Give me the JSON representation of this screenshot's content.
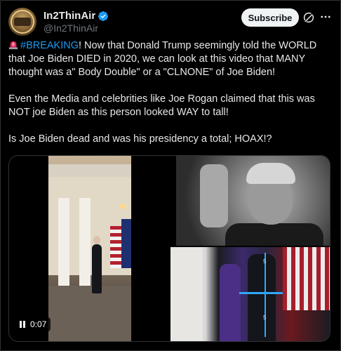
{
  "author": {
    "display_name": "In2ThinAir",
    "handle": "@In2ThinAir",
    "verified": true,
    "verified_color": "#1d9bf0"
  },
  "actions": {
    "subscribe_label": "Subscribe",
    "grok_icon": "grok-icon",
    "more_icon": "more-horizontal-icon"
  },
  "tweet": {
    "hashtag": "#BREAKING",
    "line1_rest": "! Now that Donald Trump seemingly told the WORLD that Joe Biden DIED in 2020, we can look at this video that MANY thought was a\" Body Double\" or a \"CLNONE\" of Joe Biden!",
    "paragraph2": "Even the Media and celebrities like Joe Rogan claimed that this was NOT joe Biden as this person looked WAY to tall!",
    "paragraph3": "Is Joe Biden dead and was his presidency a total; HOAX!?",
    "emoji": "siren-emoji"
  },
  "media": {
    "time": "0:07",
    "state_icon": "pause-icon",
    "overlay_numbers": [
      "5",
      "5"
    ]
  },
  "colors": {
    "background": "#000000",
    "text": "#e7e9ea",
    "secondary": "#71767b",
    "accent": "#1d9bf0"
  }
}
